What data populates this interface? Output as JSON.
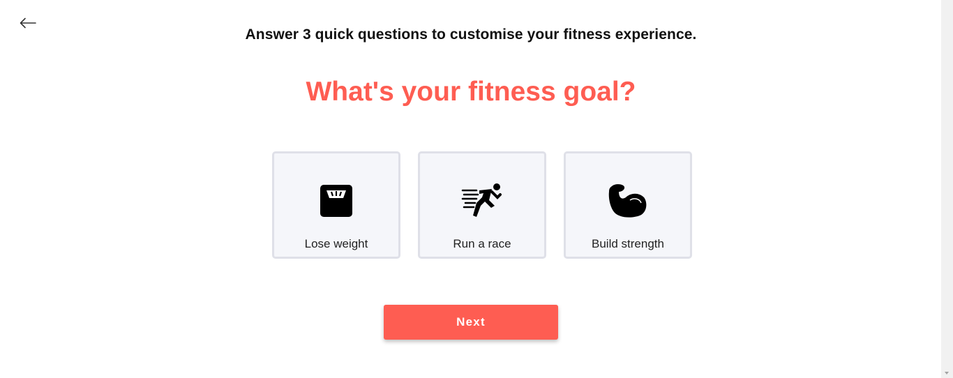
{
  "header": {
    "back_icon": "arrow-left-icon",
    "subtitle": "Answer 3 quick questions to customise your fitness experience."
  },
  "question": {
    "title": "What's your fitness goal?"
  },
  "options": [
    {
      "label": "Lose weight",
      "icon": "scale-icon"
    },
    {
      "label": "Run a race",
      "icon": "runner-icon"
    },
    {
      "label": "Build strength",
      "icon": "flexed-arm-icon"
    }
  ],
  "actions": {
    "next_label": "Next"
  },
  "colors": {
    "accent": "#fe5d52",
    "card_bg": "#f5f6fa",
    "card_border": "#dfe0e8"
  }
}
